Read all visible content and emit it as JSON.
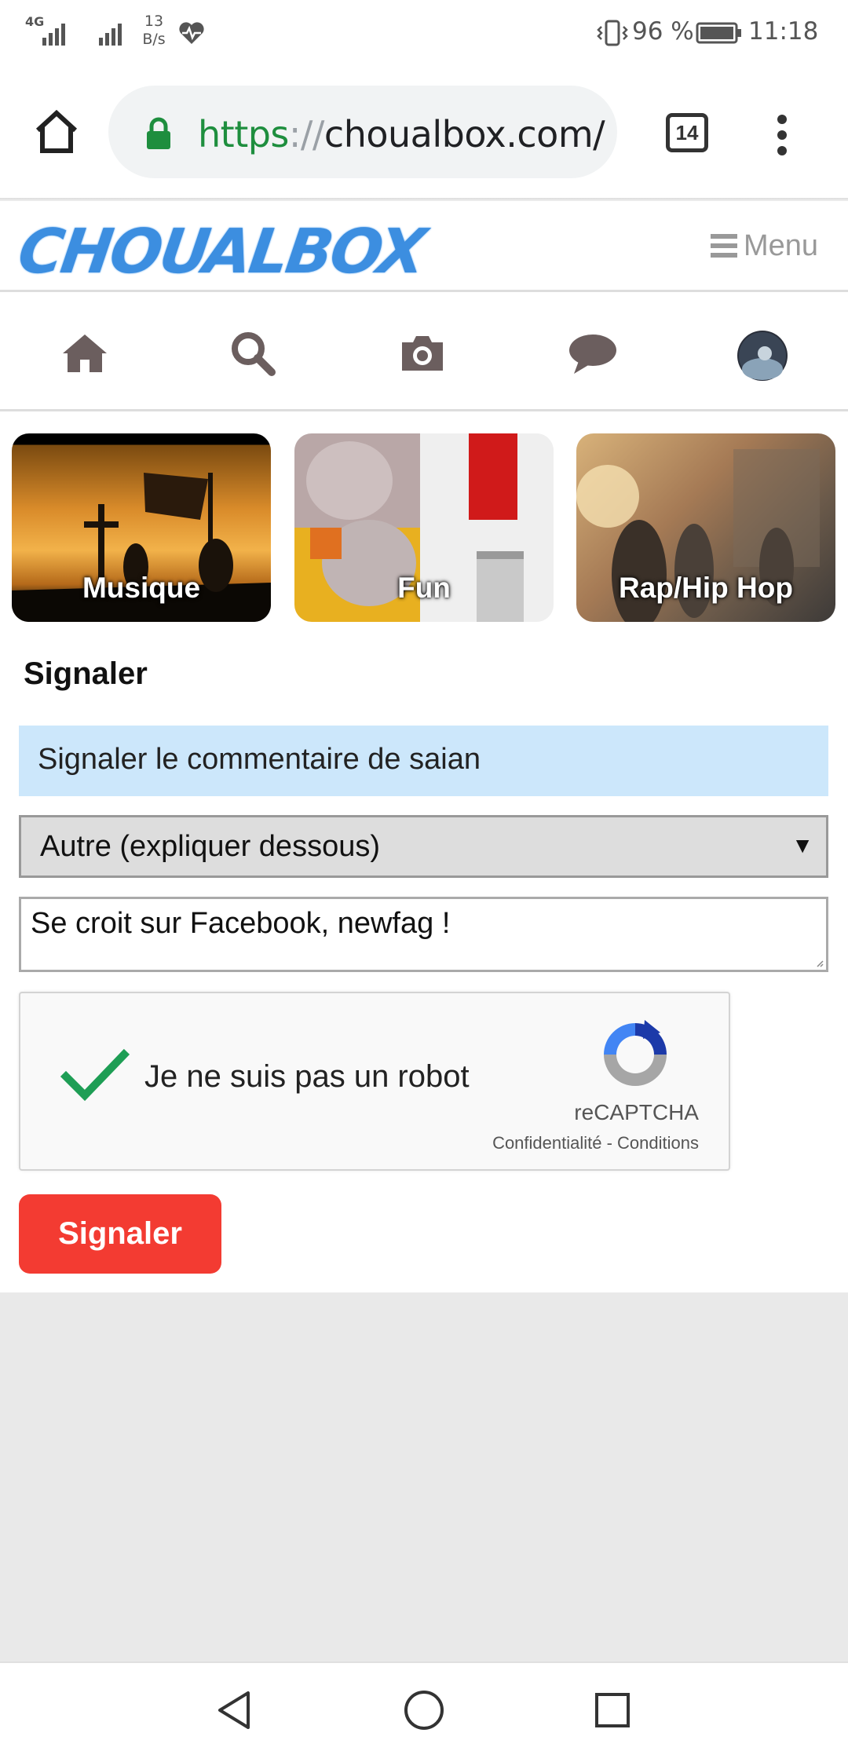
{
  "status_bar": {
    "network1": "4G",
    "speed_value": "13",
    "speed_unit": "B/s",
    "battery": "96 %",
    "time": "11:18"
  },
  "browser": {
    "url_scheme": "https",
    "url_sep": "://",
    "url_host": "choualbox.com/",
    "tab_count": "14",
    "home_icon": "home-icon",
    "lock_icon": "lock-icon",
    "overflow_icon": "more-vert-icon"
  },
  "site": {
    "logo": "CHOUALBOX",
    "menu_label": "Menu",
    "nav_icons": [
      "home-icon",
      "search-icon",
      "camera-icon",
      "chat-icon",
      "avatar"
    ]
  },
  "categories": [
    {
      "label": "Musique"
    },
    {
      "label": "Fun"
    },
    {
      "label": "Rap/Hip Hop"
    }
  ],
  "form": {
    "title": "Signaler",
    "info": "Signaler le commentaire de saian",
    "reason_selected": "Autre (expliquer dessous)",
    "comment_value": "Se croit sur Facebook, newfag !",
    "captcha_label": "Je ne suis pas un robot",
    "captcha_brand": "reCAPTCHA",
    "captcha_links": "Confidentialité - Conditions",
    "submit_label": "Signaler"
  },
  "colors": {
    "accent_red": "#f33b32",
    "info_blue": "#cce7fb",
    "logo_blue": "#3c8ee0",
    "secure_green": "#1e8e3e"
  }
}
